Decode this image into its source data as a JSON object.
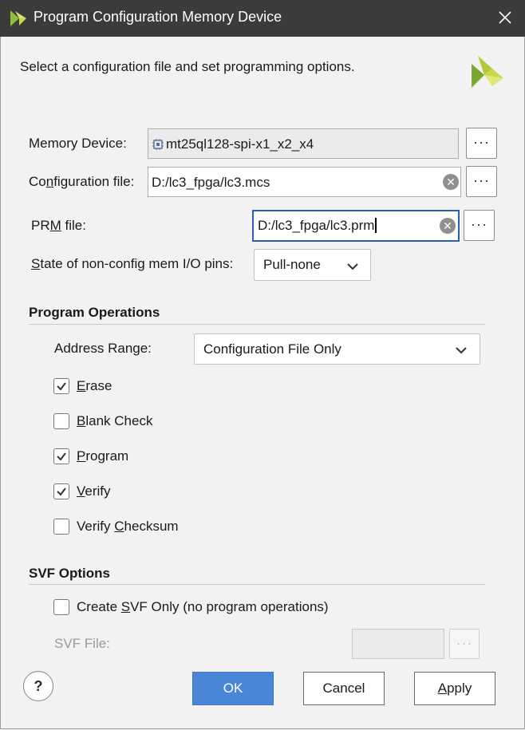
{
  "window": {
    "title": "Program Configuration Memory Device",
    "description": "Select a configuration file and set programming options."
  },
  "memory_device": {
    "label": "Memory Device:",
    "value": "mt25ql128-spi-x1_x2_x4",
    "browse": "···"
  },
  "config_file": {
    "label_pre": "Co",
    "label_u": "n",
    "label_post": "figuration file:",
    "value": "D:/lc3_fpga/lc3.mcs",
    "browse": "···"
  },
  "prm_file": {
    "label_pre": "PR",
    "label_u": "M",
    "label_post": " file:",
    "value": "D:/lc3_fpga/lc3.prm",
    "browse": "···"
  },
  "state_pins": {
    "label_pre": "",
    "label_u": "S",
    "label_post": "tate of non-config mem I/O pins:",
    "value": "Pull-none"
  },
  "program_operations": {
    "title": "Program Operations",
    "address_range_label": "Address Range:",
    "address_range_value": "Configuration File Only",
    "options": [
      {
        "pre": "",
        "u": "E",
        "post": "rase",
        "checked": true
      },
      {
        "pre": "",
        "u": "B",
        "post": "lank Check",
        "checked": false
      },
      {
        "pre": "",
        "u": "P",
        "post": "rogram",
        "checked": true
      },
      {
        "pre": "",
        "u": "V",
        "post": "erify",
        "checked": true
      },
      {
        "pre": "Verify ",
        "u": "C",
        "post": "hecksum",
        "checked": false
      }
    ]
  },
  "svf_options": {
    "title": "SVF Options",
    "create_pre": "Create ",
    "create_u": "S",
    "create_post": "VF Only (no program operations)",
    "create_checked": false,
    "svf_file_label": "SVF File:",
    "svf_file_value": "",
    "browse": "···"
  },
  "footer": {
    "help": "?",
    "ok": "OK",
    "cancel": "Cancel",
    "apply_u": "A",
    "apply_post": "pply"
  },
  "colors": {
    "titlebar": "#3b3b3b",
    "accent": "#4a86d8",
    "focus_border": "#2a5fb6"
  }
}
